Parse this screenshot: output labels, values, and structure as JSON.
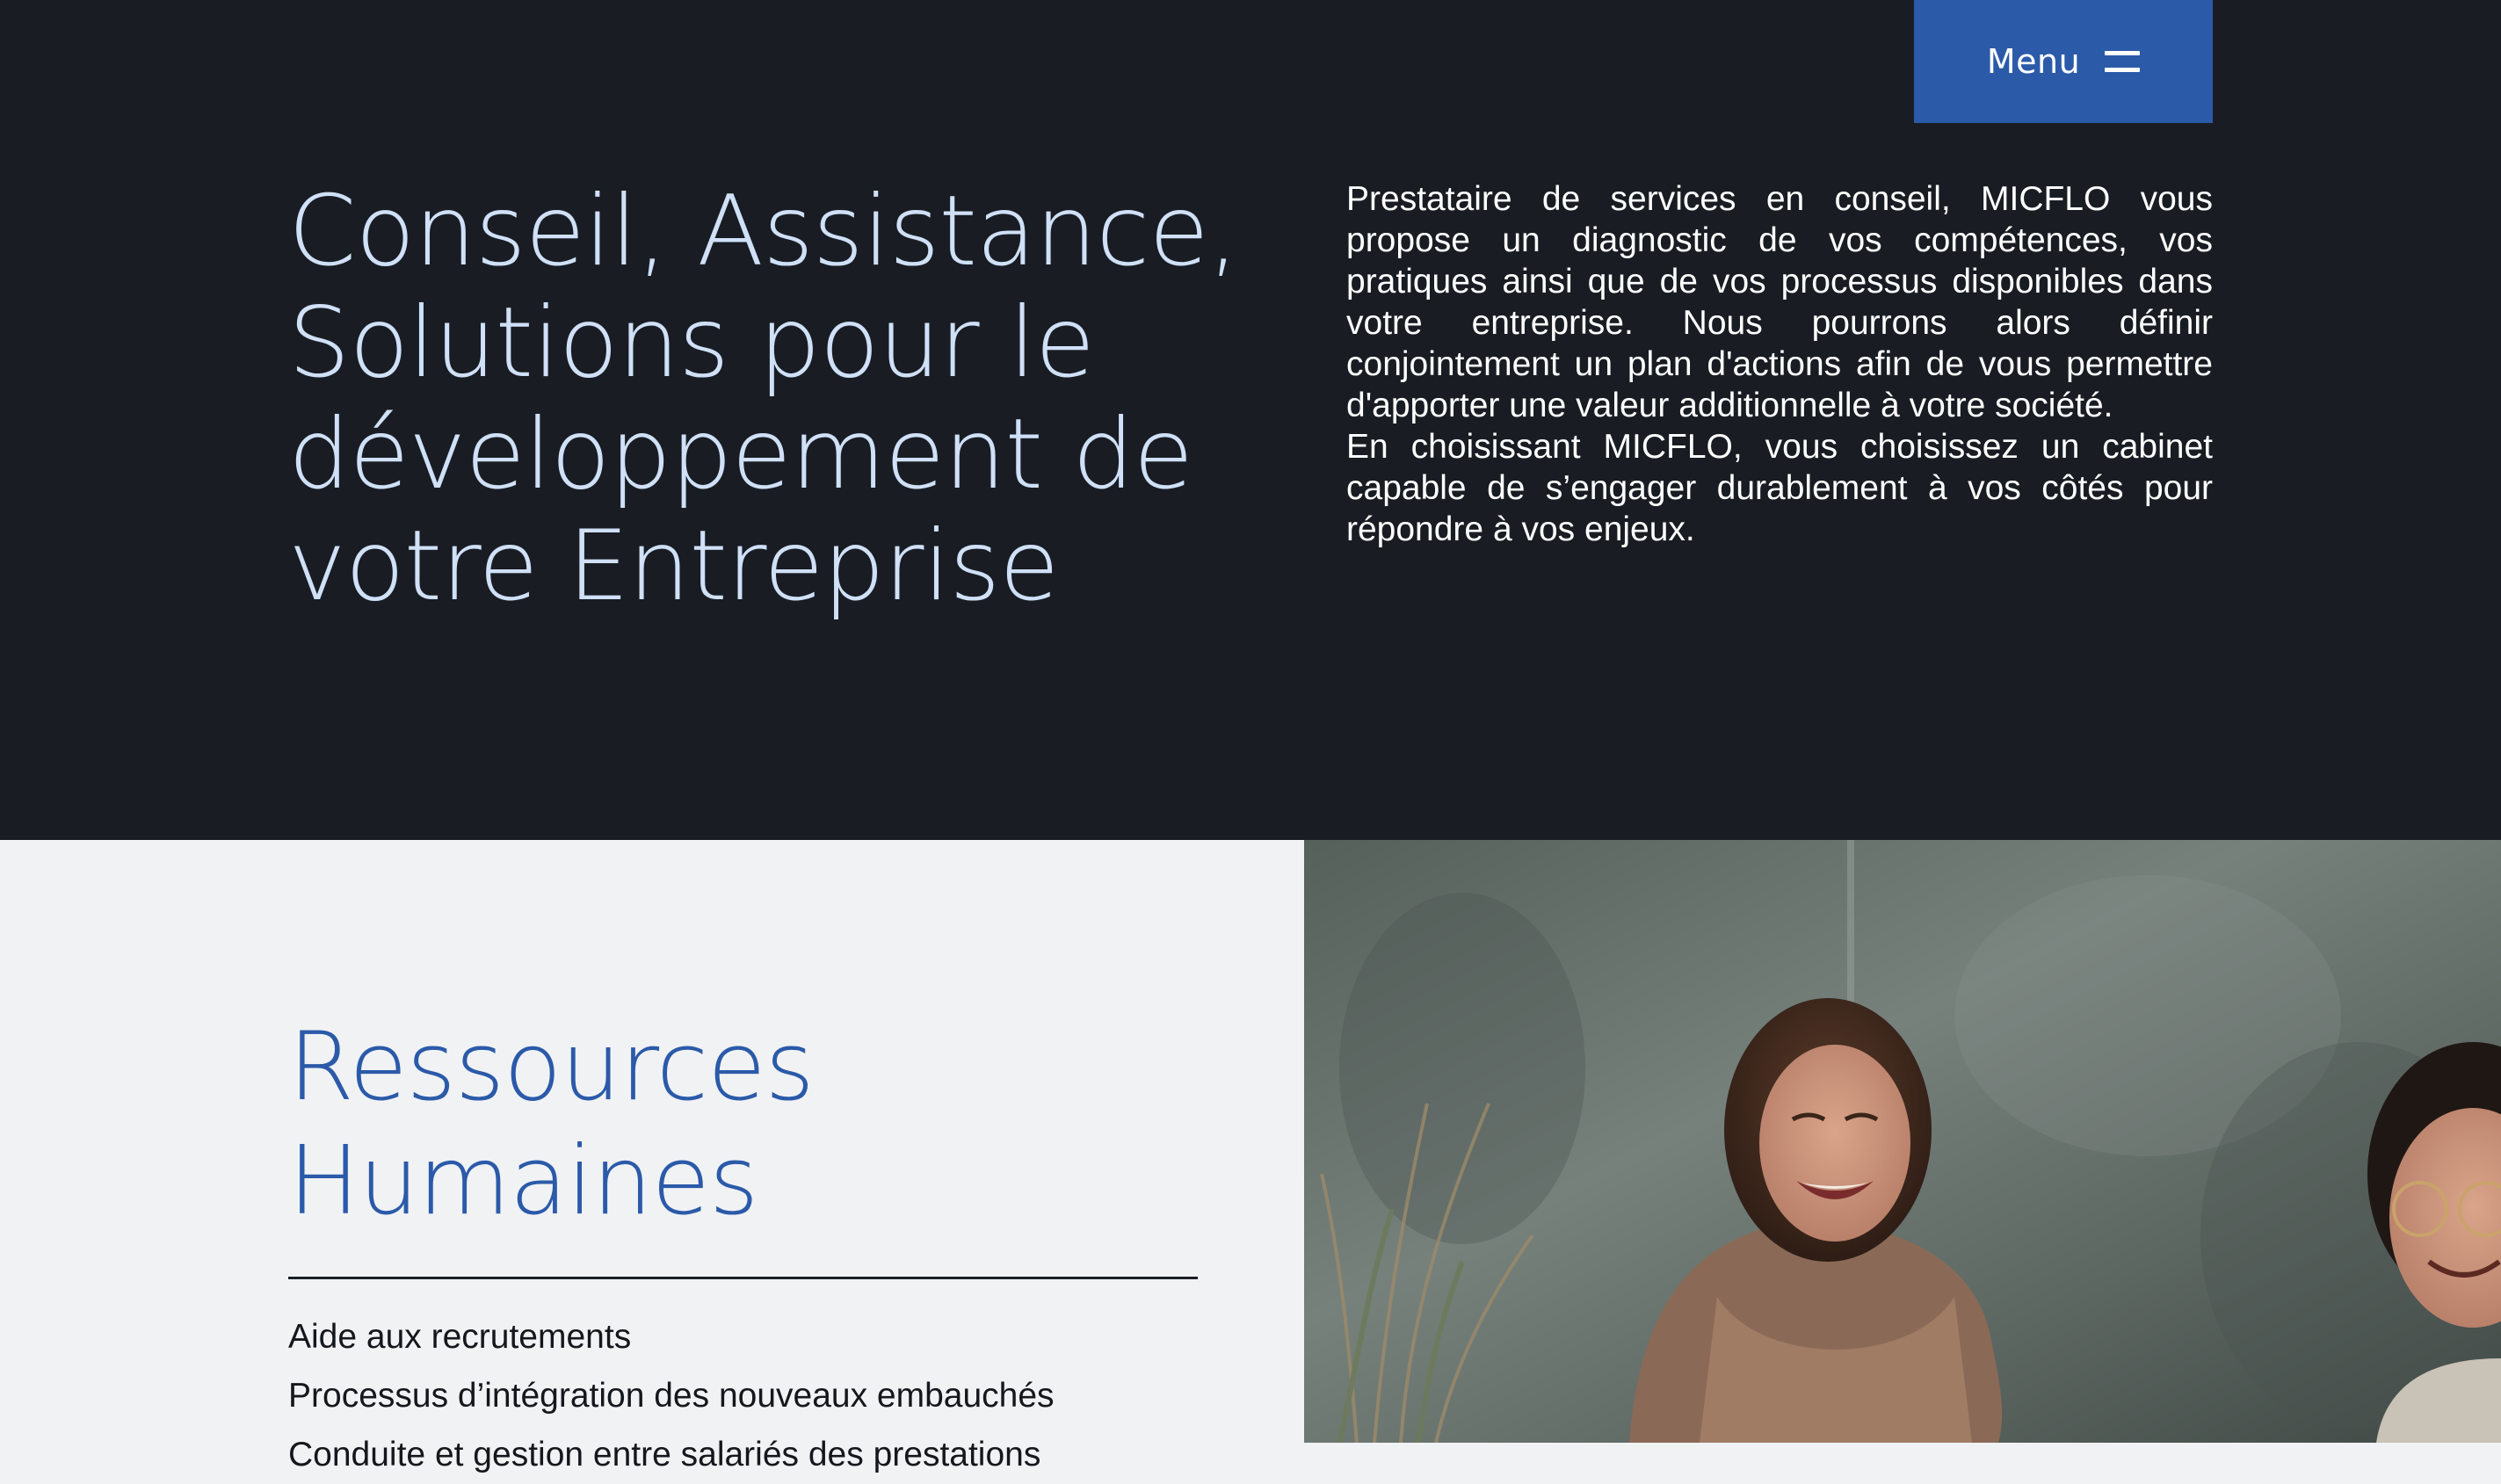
{
  "header": {
    "menu_label": "Menu",
    "menu_icon": "hamburger-icon"
  },
  "hero": {
    "title_lines": [
      "Conseil, Assistance,",
      "Solutions pour le",
      "développement de",
      "votre Entreprise"
    ],
    "paragraphs": [
      "Prestataire de services en conseil, MICFLO vous propose un diagnostic de vos compétences, vos pratiques ainsi que de vos processus disponibles dans votre entreprise. Nous pourrons alors définir conjointement un plan d'actions afin de vous permettre d'apporter une valeur additionnelle à votre société.",
      "En choisissant MICFLO, vous choisissez un cabinet capable de s’engager durablement à vos côtés pour répondre à vos enjeux."
    ]
  },
  "section": {
    "title_lines": [
      "Ressources",
      "Humaines"
    ],
    "items": [
      "Aide aux recrutements",
      "Processus d’intégration des nouveaux embauchés",
      "Conduite et gestion entre salariés des prestations"
    ]
  },
  "colors": {
    "hero_bg": "#191d23",
    "accent_blue": "#2b5aa9",
    "title_light": "#cfe0f7",
    "section_bg": "#f1f2f4"
  }
}
